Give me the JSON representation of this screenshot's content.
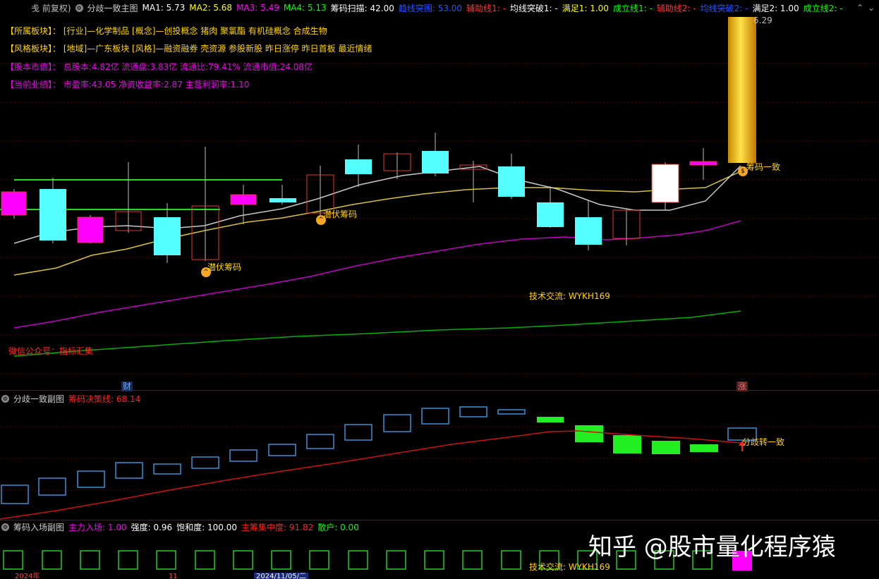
{
  "header": {
    "title": "戋 前复权)",
    "indicator_name": "分歧一致主图",
    "ma1": "MA1: 5.73",
    "ma2": "MA2: 5.68",
    "ma3": "MA3: 5.49",
    "ma4": "MA4: 5.13",
    "scan": "筹码扫描: 42.00",
    "blue1": "趋线突围: 53.00",
    "aux1": "辅助线1: -",
    "break1": "均线突破1: -",
    "full1": "满足1: 1.00",
    "form1": "成立线1: -",
    "aux2": "辅助线2: -",
    "break2": "均线突破2: -",
    "full2": "满足2: 1.00",
    "form2": "成立线2: -"
  },
  "info": {
    "row1_key": "【所属板块】：",
    "row1_val": "[行业]—化学制品  [概念]—创投概念  猪肉  聚氯酯  有机硅概念  合成生物",
    "row2_key": "【风格板块】：",
    "row2_val": "[地域]—广东板块  [风格]—融资融券  壳资源  参股新股  昨日涨停  昨日首板  最近情绪",
    "row3_key": "【股本市值】：",
    "row3_val": "总股本:4.82亿  流通盘:3.83亿  流通比:79.41%  流通市值:24.08亿",
    "row4_key": "【当前业绩】：",
    "row4_val": "市盈率:43.05  净资收益率:2.87  主营利润率:1.10"
  },
  "annotations": {
    "chip_lurk_1": "潜伏筹码",
    "chip_lurk_2": "潜伏筹码",
    "chip_agree": "筹码一致",
    "tech": "技术交流: WYKH169",
    "wechat": "微信公众号：指标汇集",
    "price_top": "6.29",
    "cai": "财",
    "zhang": "涨",
    "div_to_agree": "分歧转一致"
  },
  "sub1": {
    "name": "分歧一致副图",
    "line_label": "筹码决策线: 68.14"
  },
  "sub2": {
    "name": "筹码入场副图",
    "main_in": "主力入场: 1.00",
    "strength": "强度: 0.96",
    "saturation": "饱和度: 100.00",
    "concentration": "主筹集中度: 91.82",
    "retail": "散户: 0.00",
    "tech2": "技术交流: WYKH169"
  },
  "dates": {
    "d1": "2024年",
    "d2": "11",
    "d3": "2024/11/05/二"
  },
  "watermark": "知乎 @股市量化程序猿",
  "icons": [
    "settings-circle-icon",
    "chevron-up-icon",
    "chevron-down-icon",
    "gold-coin-icon",
    "arrow-up-icon"
  ],
  "colors": {
    "up_candle": "#ff00ff",
    "down_candle": "#55ffff",
    "hollow_up": "#e53935",
    "ma_white": "#c8c8c8",
    "ma_yellow": "#d8c23a",
    "ma_magenta": "#c000c0",
    "ma_green": "#00b000",
    "gold": "#f0c000"
  }
}
